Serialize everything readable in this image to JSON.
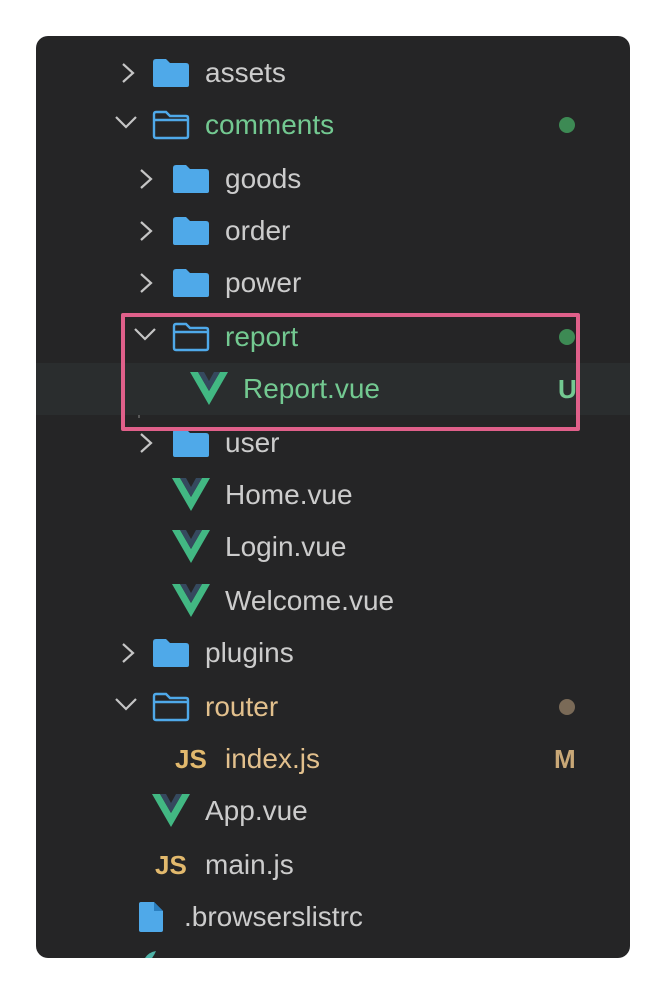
{
  "explorer": {
    "items": [
      {
        "name": "assets",
        "kind": "folder",
        "expanded": false,
        "depth": 0
      },
      {
        "name": "comments",
        "kind": "folder",
        "expanded": true,
        "depth": 0,
        "status": "dot",
        "status_color": "#3d8a54"
      },
      {
        "name": "goods",
        "kind": "folder",
        "expanded": false,
        "depth": 1
      },
      {
        "name": "order",
        "kind": "folder",
        "expanded": false,
        "depth": 1
      },
      {
        "name": "power",
        "kind": "folder",
        "expanded": false,
        "depth": 1
      },
      {
        "name": "report",
        "kind": "folder",
        "expanded": true,
        "depth": 1,
        "status": "dot",
        "status_color": "#3d8a54"
      },
      {
        "name": "Report.vue",
        "kind": "vue",
        "depth": 2,
        "status": "U",
        "status_color": "#73c991",
        "selected": true
      },
      {
        "name": "user",
        "kind": "folder",
        "expanded": false,
        "depth": 1
      },
      {
        "name": "Home.vue",
        "kind": "vue",
        "depth": 1
      },
      {
        "name": "Login.vue",
        "kind": "vue",
        "depth": 1
      },
      {
        "name": "Welcome.vue",
        "kind": "vue",
        "depth": 1
      },
      {
        "name": "plugins",
        "kind": "folder",
        "expanded": false,
        "depth": 0
      },
      {
        "name": "router",
        "kind": "folder",
        "expanded": true,
        "depth": 0,
        "status": "dot",
        "status_color": "#7a6a57"
      },
      {
        "name": "index.js",
        "kind": "js",
        "depth": 1,
        "status": "M",
        "status_color": "#c9a877"
      },
      {
        "name": "App.vue",
        "kind": "vue",
        "depth": 0
      },
      {
        "name": "main.js",
        "kind": "js",
        "depth": 0
      },
      {
        "name": ".browserslistrc",
        "kind": "file",
        "depth": -1
      }
    ],
    "js_icon_text": "JS"
  },
  "colors": {
    "folder": "#4fa9e9",
    "vue_outer": "#42b883",
    "vue_inner": "#35495e",
    "modified_label": "#73c991",
    "router_label": "#e2c08d",
    "highlight": "#e0608a"
  }
}
